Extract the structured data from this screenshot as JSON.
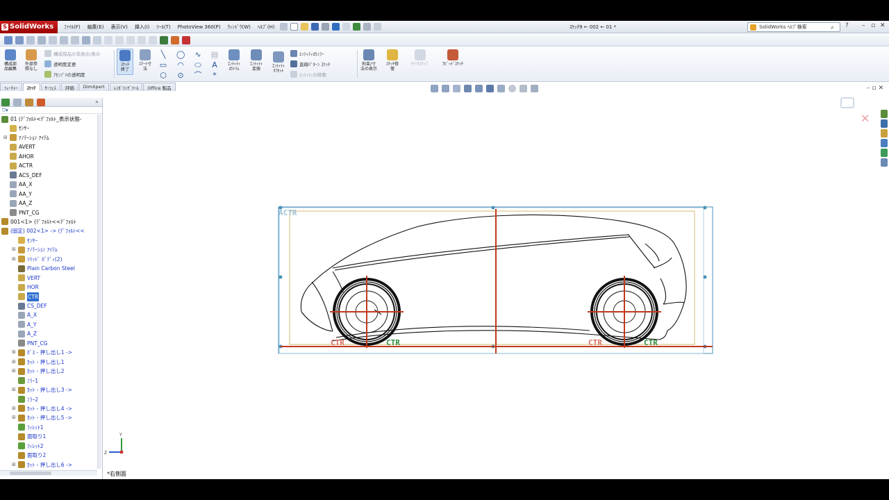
{
  "titlebar": {
    "app_name": "SolidWorks",
    "menus": [
      "ﾌｧｲﾙ(F)",
      "編集(E)",
      "表示(V)",
      "挿入(I)",
      "ﾂｰﾙ(T)",
      "PhotoView 360(P)",
      "ｳｨﾝﾄﾞｳ(W)",
      "ﾍﾙﾌﾟ(H)"
    ],
    "document_title": "ｽｹｯﾁ9 ← 002 ← 01 *",
    "help_search": "SolidWorks ﾍﾙﾌﾟ検索",
    "help_icon": "?"
  },
  "command_manager": {
    "assembly_display": "構成部\n品編集",
    "external_refs": "外部参\n照なし",
    "hide_components": "構成部品の非表示/表示",
    "transparency": "透明度変更",
    "assembly_transparency": "ｱｾﾝﾌﾞﾘの透明度",
    "exit_sketch": "ｽｹｯﾁ\n終了",
    "smart_dimension": "ｽﾏｰﾄ寸\n法",
    "trim_entities": "ｴﾝﾃｨﾃｨ\nのﾄﾘﾑ",
    "convert_entities": "ｴﾝﾃｨﾃｨ\n変換",
    "offset_entities": "ｴﾝﾃｨﾃｨ\nｵﾌｾｯﾄ",
    "mirror_entities": "ｴﾝﾃｨﾃｨのﾐﾗｰ",
    "linear_pattern": "直線ﾊﾟﾀｰﾝ ｽｹｯﾁ",
    "move_entities": "ｴﾝﾃｨﾃｨの移動",
    "display_relations": "拘束/寸\n法の表示",
    "repair_sketch": "ｽｹｯﾁ修\n復",
    "quick_snaps": "ｸｲｯｸｽﾅｯﾌﾟ",
    "rapid_sketch": "ﾗﾋﾟｯﾄﾞｽｹｯﾁ"
  },
  "tabs": [
    "ﾌｨｰﾁｬｰ",
    "ｽｹｯﾁ",
    "ｻｰﾌｪｽ",
    "評価",
    "DimXpert",
    "ﾚﾝﾀﾞﾘﾝｸﾞﾂｰﾙ",
    "Office 製品"
  ],
  "active_tab": "ｽｹｯﾁ",
  "tree": [
    {
      "label": "01 (ﾃﾞﾌｫﾙﾄ<ﾃﾞﾌｫﾙﾄ_表示状態-",
      "blue": false
    },
    {
      "label": "ｾﾝｻｰ",
      "blue": false
    },
    {
      "label": "ｱﾉﾃｰｼｮﾝ ｱｲﾃﾑ",
      "blue": false
    },
    {
      "label": "AVERT",
      "blue": false
    },
    {
      "label": "AHOR",
      "blue": false
    },
    {
      "label": "ACTR",
      "blue": false
    },
    {
      "label": "ACS_DEF",
      "blue": false
    },
    {
      "label": "AA_X",
      "blue": false
    },
    {
      "label": "AA_Y",
      "blue": false
    },
    {
      "label": "AA_Z",
      "blue": false
    },
    {
      "label": "PNT_CG",
      "blue": false
    },
    {
      "label": "001<1> (ﾃﾞﾌｫﾙﾄ<<ﾃﾞﾌｫﾙﾄ",
      "blue": false
    },
    {
      "label": "(固定) 002<1> -> (ﾃﾞﾌｫﾙﾄ<<",
      "blue": true
    },
    {
      "label": "ｾﾝｻｰ",
      "blue": true
    },
    {
      "label": "ｱﾉﾃｰｼｮﾝ ｱｲﾃﾑ",
      "blue": true
    },
    {
      "label": "ｿﾘｯﾄﾞ ﾎﾞﾃﾞｨ(2)",
      "blue": true
    },
    {
      "label": "Plain Carbon Steel",
      "blue": true
    },
    {
      "label": "VERT",
      "blue": true
    },
    {
      "label": "HOR",
      "blue": true
    },
    {
      "label": "CTR",
      "blue": true,
      "selected": true
    },
    {
      "label": "CS_DEF",
      "blue": true
    },
    {
      "label": "A_X",
      "blue": true
    },
    {
      "label": "A_Y",
      "blue": true
    },
    {
      "label": "A_Z",
      "blue": true
    },
    {
      "label": "PNT_CG",
      "blue": true
    },
    {
      "label": "ﾎﾞｽ - 押し出し1 ->",
      "blue": true
    },
    {
      "label": "ｶｯﾄ - 押し出し1",
      "blue": true
    },
    {
      "label": "ｶｯﾄ - 押し出し2",
      "blue": true
    },
    {
      "label": "ﾐﾗｰ1",
      "blue": true
    },
    {
      "label": "ｶｯﾄ - 押し出し3 ->",
      "blue": true
    },
    {
      "label": "ﾐﾗｰ2",
      "blue": true
    },
    {
      "label": "ｶｯﾄ - 押し出し4 ->",
      "blue": true
    },
    {
      "label": "ｶｯﾄ - 押し出し5 ->",
      "blue": true
    },
    {
      "label": "ﾌｨﾚｯﾄ1",
      "blue": true
    },
    {
      "label": "面取り1",
      "blue": true
    },
    {
      "label": "ﾌｨﾚｯﾄ2",
      "blue": true
    },
    {
      "label": "面取り2",
      "blue": true
    },
    {
      "label": "ｶｯﾄ - 押し出し6 ->",
      "blue": true
    }
  ],
  "canvas": {
    "acs_label": "ACTR",
    "ctr_label": "CTR",
    "triad_y": "Y",
    "triad_z": "Z",
    "view_name": "*右側面"
  },
  "colors": {
    "sketch_line": "#111111",
    "centerline": "#c0391b",
    "selection_box": "#4a90b8",
    "ctr_label": "#2e8b3d",
    "frame": "#c9a94a"
  }
}
